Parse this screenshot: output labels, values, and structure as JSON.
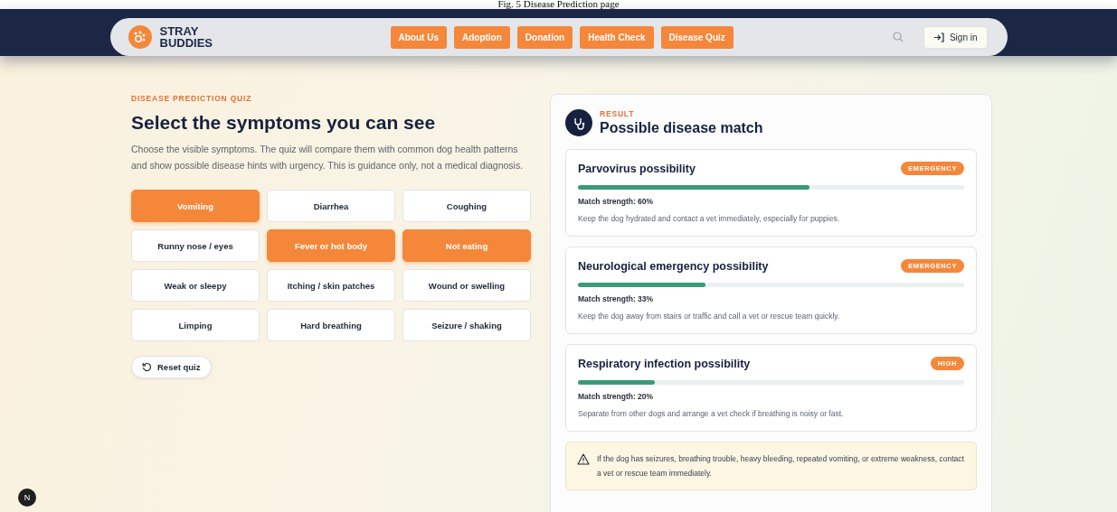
{
  "caption": "Fig. 5 Disease Prediction page",
  "brand": {
    "name": "STRAY BUDDIES"
  },
  "nav": [
    {
      "label": "About Us"
    },
    {
      "label": "Adoption"
    },
    {
      "label": "Donation"
    },
    {
      "label": "Health Check"
    },
    {
      "label": "Disease Quiz"
    }
  ],
  "sign_in": "Sign in",
  "quiz": {
    "eyebrow": "DISEASE PREDICTION QUIZ",
    "title": "Select the symptoms you can see",
    "description": "Choose the visible symptoms. The quiz will compare them with common dog health patterns and show possible disease hints with urgency. This is guidance only, not a medical diagnosis.",
    "symptoms": [
      {
        "label": "Vomiting",
        "selected": true
      },
      {
        "label": "Diarrhea",
        "selected": false
      },
      {
        "label": "Coughing",
        "selected": false
      },
      {
        "label": "Runny nose / eyes",
        "selected": false
      },
      {
        "label": "Fever or hot body",
        "selected": true
      },
      {
        "label": "Not eating",
        "selected": true
      },
      {
        "label": "Weak or sleepy",
        "selected": false
      },
      {
        "label": "Itching / skin patches",
        "selected": false
      },
      {
        "label": "Wound or swelling",
        "selected": false
      },
      {
        "label": "Limping",
        "selected": false
      },
      {
        "label": "Hard breathing",
        "selected": false
      },
      {
        "label": "Seizure / shaking",
        "selected": false
      }
    ],
    "reset": "Reset quiz"
  },
  "result": {
    "eyebrow": "RESULT",
    "title": "Possible disease match",
    "matches": [
      {
        "name": "Parvovirus possibility",
        "badge": "EMERGENCY",
        "level": 0.6,
        "strength": "Match strength: 60%",
        "advice": "Keep the dog hydrated and contact a vet immediately, especially for puppies."
      },
      {
        "name": "Neurological emergency possibility",
        "badge": "EMERGENCY",
        "level": 0.33,
        "strength": "Match strength: 33%",
        "advice": "Keep the dog away from stairs or traffic and call a vet or rescue team quickly."
      },
      {
        "name": "Respiratory infection possibility",
        "badge": "HIGH",
        "level": 0.2,
        "strength": "Match strength: 20%",
        "advice": "Separate from other dogs and arrange a vet check if breathing is noisy or fast."
      }
    ],
    "warning": "If the dog has seizures, breathing trouble, heavy bleeding, repeated vomiting, or extreme weakness, contact a vet or rescue team immediately."
  },
  "dev_badge": "N"
}
